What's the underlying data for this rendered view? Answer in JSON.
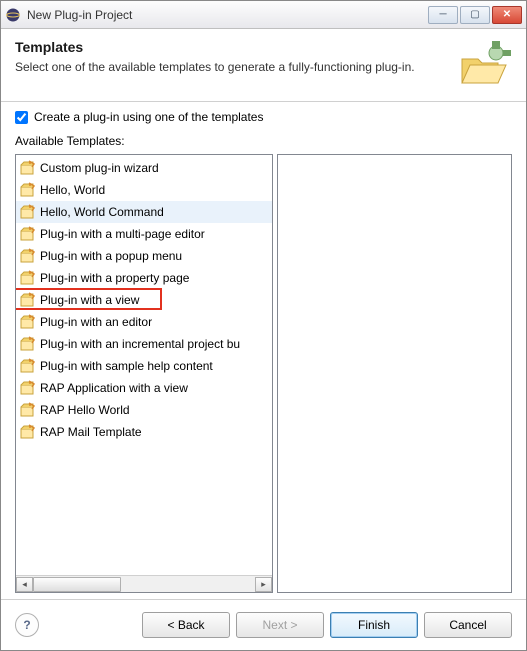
{
  "window": {
    "title": "New Plug-in Project"
  },
  "header": {
    "title": "Templates",
    "description": "Select one of the available templates to generate a fully-functioning plug-in."
  },
  "checkbox": {
    "label": "Create a plug-in using one of the templates",
    "checked": true
  },
  "listLabel": "Available Templates:",
  "templates": [
    {
      "label": "Custom plug-in wizard",
      "hovered": false,
      "highlighted": false
    },
    {
      "label": "Hello, World",
      "hovered": false,
      "highlighted": false
    },
    {
      "label": "Hello, World Command",
      "hovered": true,
      "highlighted": false
    },
    {
      "label": "Plug-in with a multi-page editor",
      "hovered": false,
      "highlighted": false
    },
    {
      "label": "Plug-in with a popup menu",
      "hovered": false,
      "highlighted": false
    },
    {
      "label": "Plug-in with a property page",
      "hovered": false,
      "highlighted": false
    },
    {
      "label": "Plug-in with a view",
      "hovered": false,
      "highlighted": true
    },
    {
      "label": "Plug-in with an editor",
      "hovered": false,
      "highlighted": false
    },
    {
      "label": "Plug-in with an incremental project bu",
      "hovered": false,
      "highlighted": false
    },
    {
      "label": "Plug-in with sample help content",
      "hovered": false,
      "highlighted": false
    },
    {
      "label": "RAP Application with a view",
      "hovered": false,
      "highlighted": false
    },
    {
      "label": "RAP Hello World",
      "hovered": false,
      "highlighted": false
    },
    {
      "label": "RAP Mail Template",
      "hovered": false,
      "highlighted": false
    }
  ],
  "buttons": {
    "back": "< Back",
    "next": "Next >",
    "finish": "Finish",
    "cancel": "Cancel"
  }
}
